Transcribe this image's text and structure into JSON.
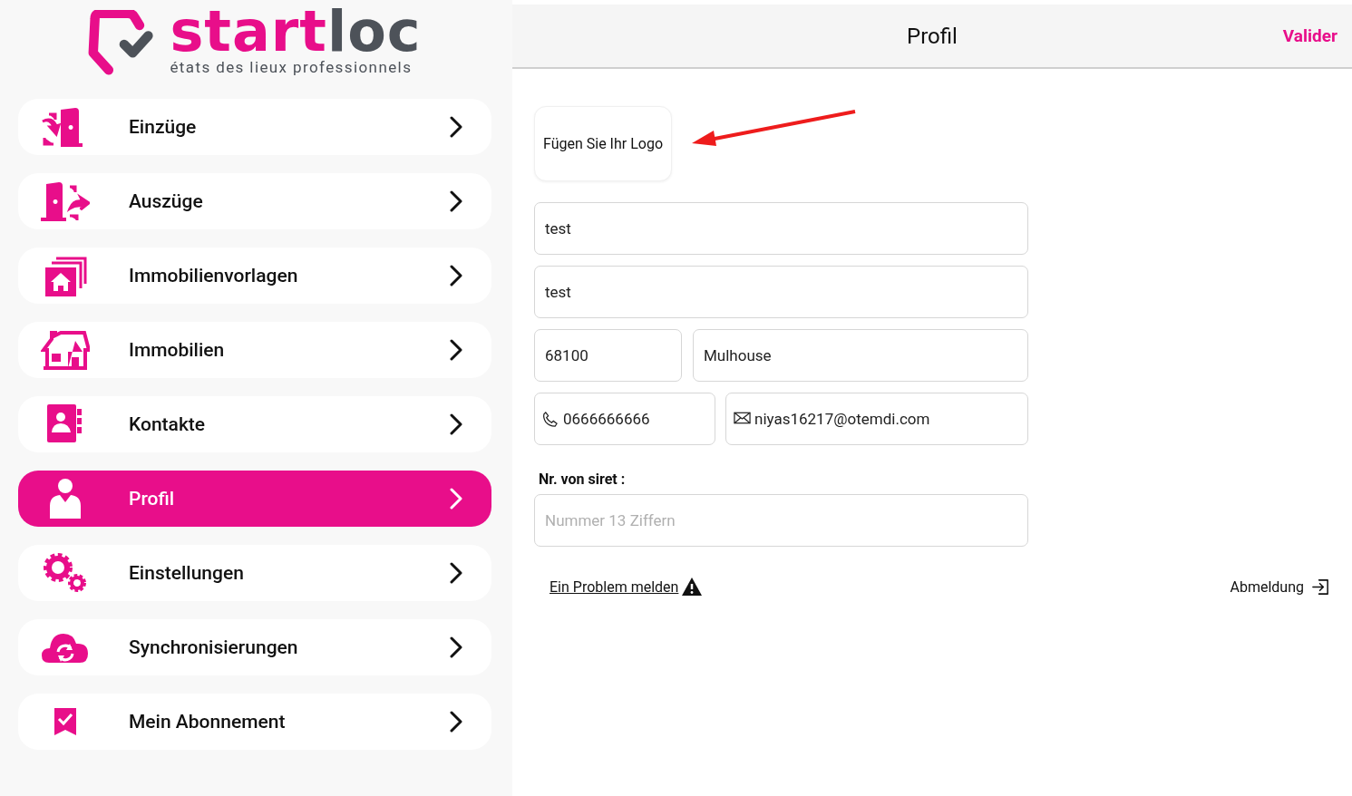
{
  "logo": {
    "name_primary": "start",
    "name_secondary": "loc",
    "tagline": "états des lieux professionnels"
  },
  "sidebar": {
    "items": [
      {
        "label": "Einzüge",
        "selected": false
      },
      {
        "label": "Auszüge",
        "selected": false
      },
      {
        "label": "Immobilienvorlagen",
        "selected": false
      },
      {
        "label": "Immobilien",
        "selected": false
      },
      {
        "label": "Kontakte",
        "selected": false
      },
      {
        "label": "Profil",
        "selected": true
      },
      {
        "label": "Einstellungen",
        "selected": false
      },
      {
        "label": "Synchronisierungen",
        "selected": false
      },
      {
        "label": "Mein Abonnement",
        "selected": false
      }
    ]
  },
  "header": {
    "title": "Profil",
    "action": "Valider"
  },
  "logo_upload": {
    "label": "Fügen Sie Ihr Logo",
    "annotation": {
      "kind": "arrow"
    }
  },
  "form": {
    "rows": [
      [
        {
          "kind": "text",
          "value": "test"
        }
      ],
      [
        {
          "kind": "text",
          "value": "test"
        }
      ],
      [
        {
          "kind": "text",
          "value": "68100"
        },
        {
          "kind": "text",
          "value": "Mulhouse"
        }
      ],
      [
        {
          "kind": "phone",
          "value": "0666666666"
        },
        {
          "kind": "email",
          "value": "niyas16217@otemdi.com"
        }
      ]
    ],
    "siret_label": "Nr. von siret :",
    "siret_placeholder": "Nummer 13 Ziffern"
  },
  "footer": {
    "report_link": "Ein Problem melden",
    "logout": "Abmeldung"
  }
}
